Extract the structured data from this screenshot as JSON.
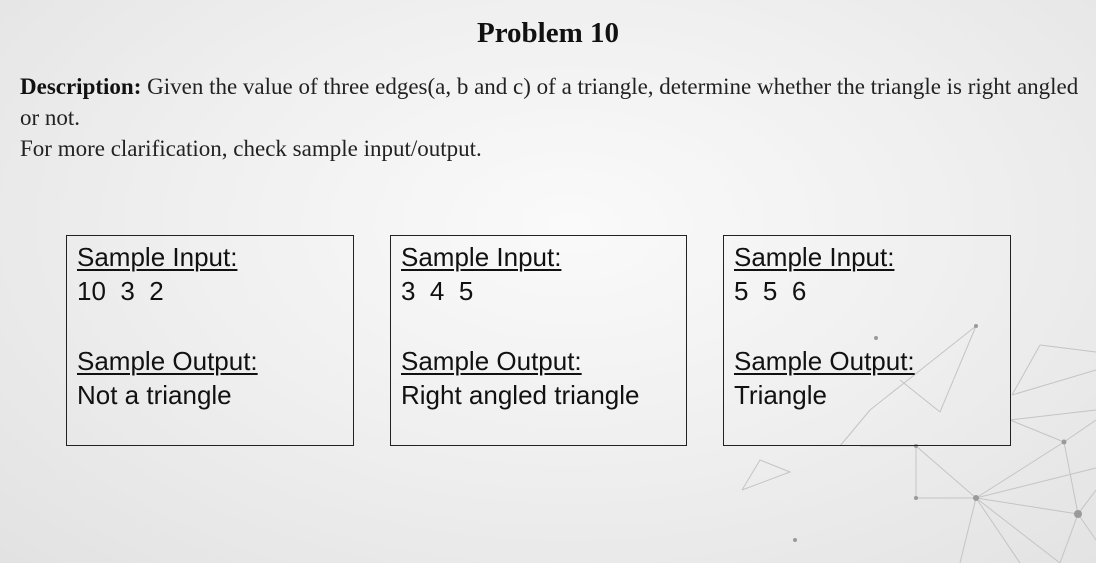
{
  "problem": {
    "title": "Problem 10"
  },
  "description": {
    "label": "Description:",
    "text": " Given the value of three edges(a, b and c) of a triangle, determine whether the triangle is right angled or not.",
    "note": "For more clarification, check sample input/output."
  },
  "samples": [
    {
      "input_heading": "Sample Input:",
      "input_value": "10  3  2",
      "output_heading": "Sample Output:",
      "output_value": "Not a triangle"
    },
    {
      "input_heading": "Sample Input:",
      "input_value": "3  4  5",
      "output_heading": "Sample Output:",
      "output_value": "Right angled triangle"
    },
    {
      "input_heading": "Sample Input:",
      "input_value": "5  5  6",
      "output_heading": "Sample Output:",
      "output_value": "Triangle"
    }
  ],
  "colors": {
    "text": "#111111",
    "box_border": "#222222",
    "decor_line": "#bdbdbd",
    "decor_dot": "#9a9a9a"
  }
}
